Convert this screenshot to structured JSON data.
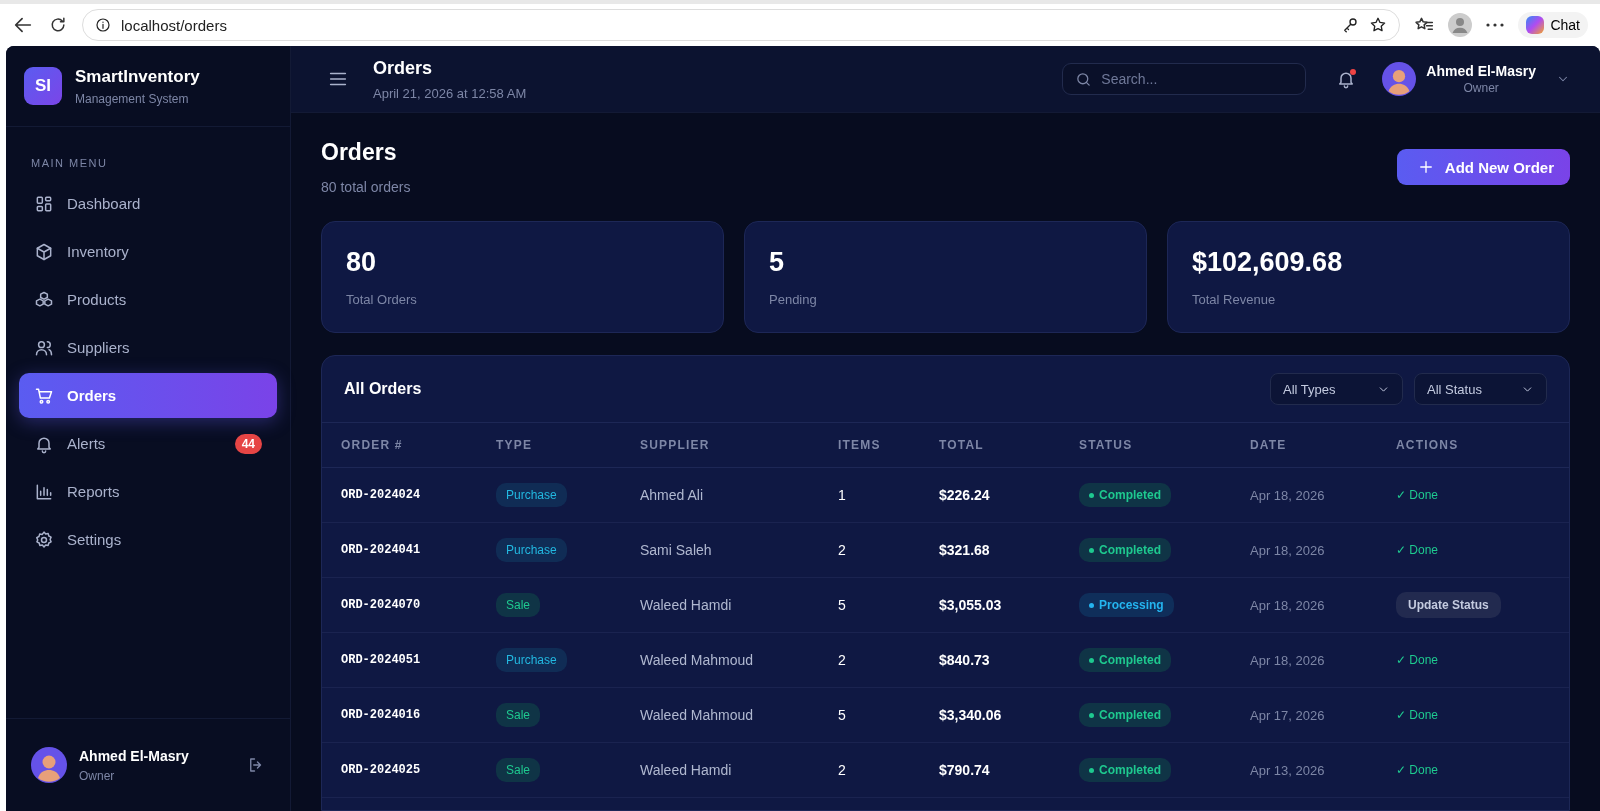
{
  "browser": {
    "url": "localhost/orders",
    "chat_label": "Chat"
  },
  "sidebar": {
    "logo": "SI",
    "brand": "SmartInventory",
    "tagline": "Management System",
    "section_label": "MAIN MENU",
    "items": [
      {
        "label": "Dashboard",
        "selected": false
      },
      {
        "label": "Inventory",
        "selected": false
      },
      {
        "label": "Products",
        "selected": false
      },
      {
        "label": "Suppliers",
        "selected": false
      },
      {
        "label": "Orders",
        "selected": true
      },
      {
        "label": "Alerts",
        "selected": false,
        "badge": "44"
      },
      {
        "label": "Reports",
        "selected": false
      },
      {
        "label": "Settings",
        "selected": false
      }
    ],
    "user": {
      "name": "Ahmed El-Masry",
      "role": "Owner"
    }
  },
  "header": {
    "title": "Orders",
    "timestamp": "April 21, 2026 at 12:58 AM",
    "search": {
      "placeholder": "Search..."
    },
    "user": {
      "name": "Ahmed El-Masry",
      "role": "Owner"
    }
  },
  "page": {
    "title": "Orders",
    "subtitle": "80 total orders",
    "add_button": "Add New Order"
  },
  "stats": [
    {
      "value": "80",
      "label": "Total Orders"
    },
    {
      "value": "5",
      "label": "Pending"
    },
    {
      "value": "$102,609.68",
      "label": "Total Revenue"
    }
  ],
  "table": {
    "title": "All Orders",
    "filters": [
      "All Types",
      "All Status"
    ],
    "columns": [
      "ORDER #",
      "TYPE",
      "SUPPLIER",
      "ITEMS",
      "TOTAL",
      "STATUS",
      "DATE",
      "ACTIONS"
    ],
    "rows": [
      {
        "order": "ORD-2024024",
        "type": {
          "label": "Purchase",
          "kind": "purchase"
        },
        "supplier": "Ahmed Ali",
        "items": "1",
        "total": "$226.24",
        "status": {
          "label": "Completed",
          "kind": "completed"
        },
        "date": "Apr 18, 2026",
        "action": {
          "label": "✓ Done",
          "kind": "done"
        }
      },
      {
        "order": "ORD-2024041",
        "type": {
          "label": "Purchase",
          "kind": "purchase"
        },
        "supplier": "Sami Saleh",
        "items": "2",
        "total": "$321.68",
        "status": {
          "label": "Completed",
          "kind": "completed"
        },
        "date": "Apr 18, 2026",
        "action": {
          "label": "✓ Done",
          "kind": "done"
        }
      },
      {
        "order": "ORD-2024070",
        "type": {
          "label": "Sale",
          "kind": "sale"
        },
        "supplier": "Waleed Hamdi",
        "items": "5",
        "total": "$3,055.03",
        "status": {
          "label": "Processing",
          "kind": "processing"
        },
        "date": "Apr 18, 2026",
        "action": {
          "label": "Update Status",
          "kind": "button"
        }
      },
      {
        "order": "ORD-2024051",
        "type": {
          "label": "Purchase",
          "kind": "purchase"
        },
        "supplier": "Waleed Mahmoud",
        "items": "2",
        "total": "$840.73",
        "status": {
          "label": "Completed",
          "kind": "completed"
        },
        "date": "Apr 18, 2026",
        "action": {
          "label": "✓ Done",
          "kind": "done"
        }
      },
      {
        "order": "ORD-2024016",
        "type": {
          "label": "Sale",
          "kind": "sale"
        },
        "supplier": "Waleed Mahmoud",
        "items": "5",
        "total": "$3,340.06",
        "status": {
          "label": "Completed",
          "kind": "completed"
        },
        "date": "Apr 17, 2026",
        "action": {
          "label": "✓ Done",
          "kind": "done"
        }
      },
      {
        "order": "ORD-2024025",
        "type": {
          "label": "Sale",
          "kind": "sale"
        },
        "supplier": "Waleed Hamdi",
        "items": "2",
        "total": "$790.74",
        "status": {
          "label": "Completed",
          "kind": "completed"
        },
        "date": "Apr 13, 2026",
        "action": {
          "label": "✓ Done",
          "kind": "done"
        }
      }
    ]
  }
}
